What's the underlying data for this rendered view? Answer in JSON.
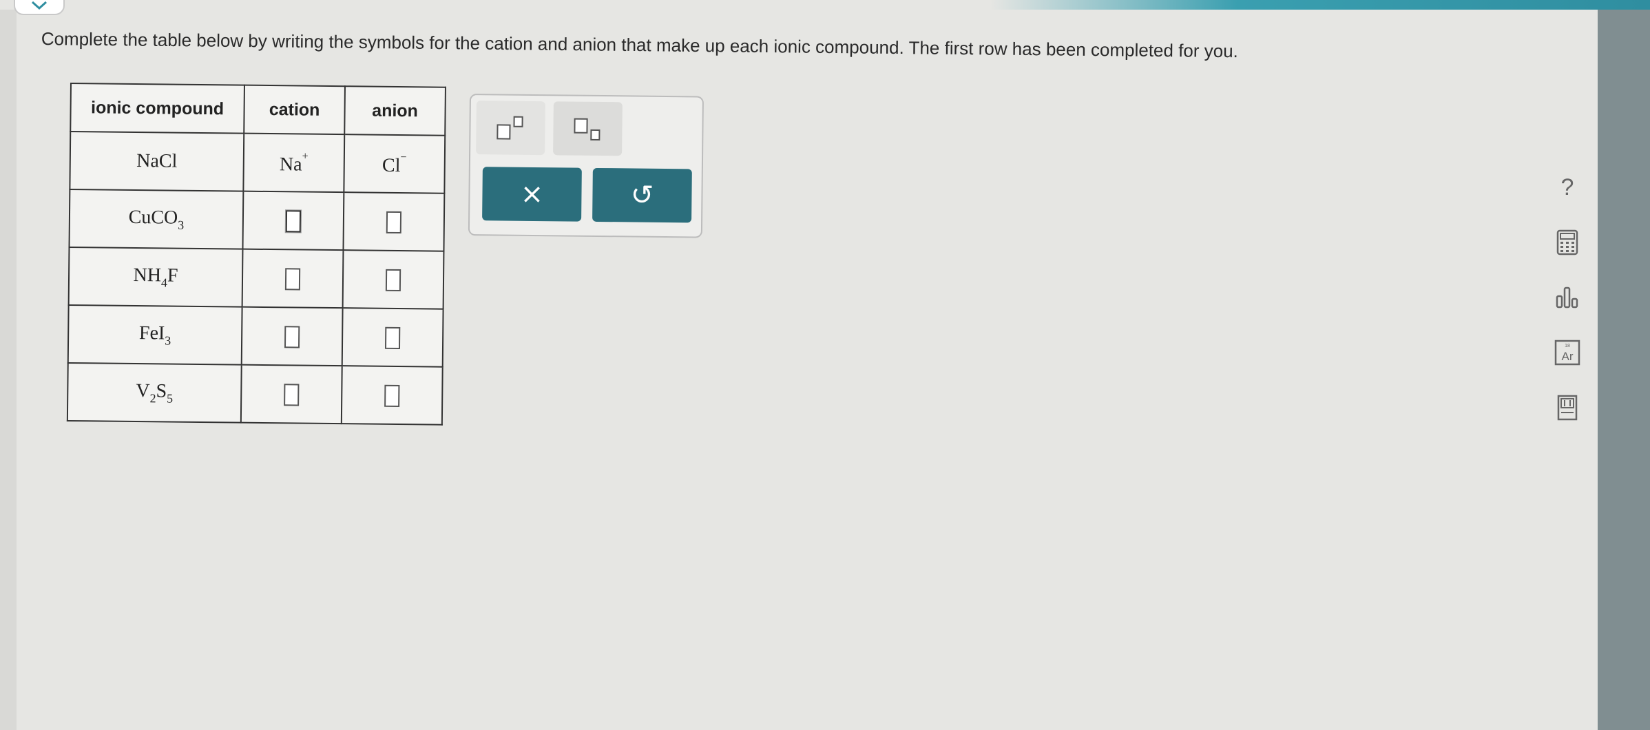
{
  "instruction": "Complete the table below by writing the symbols for the cation and anion that make up each ionic compound. The first row has been completed for you.",
  "table": {
    "headers": [
      "ionic compound",
      "cation",
      "anion"
    ],
    "rows": [
      {
        "compound": {
          "base": "NaCl"
        },
        "cation": {
          "symbol": "Na",
          "charge": "+"
        },
        "anion": {
          "symbol": "Cl",
          "charge": "−"
        }
      },
      {
        "compound": {
          "parts": [
            "CuCO",
            "3"
          ]
        },
        "cation": null,
        "anion": null
      },
      {
        "compound": {
          "parts": [
            "NH",
            "4",
            "F"
          ]
        },
        "cation": null,
        "anion": null
      },
      {
        "compound": {
          "parts": [
            "FeI",
            "3"
          ]
        },
        "cation": null,
        "anion": null
      },
      {
        "compound": {
          "parts": [
            "V",
            "2",
            "S",
            "5"
          ]
        },
        "cation": null,
        "anion": null
      }
    ]
  },
  "toolbox": {
    "clear_symbol": "×",
    "undo_symbol": "↺"
  },
  "side_tools": {
    "help_symbol": "?",
    "periodic_label": "Ar",
    "periodic_number": "18"
  },
  "colors": {
    "accent_button": "#2b6e7c",
    "top_bar": "#3a9fb0"
  }
}
